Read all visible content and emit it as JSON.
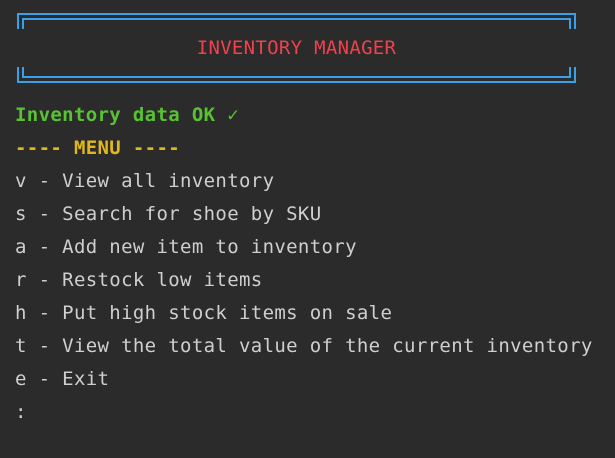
{
  "banner": {
    "title": "INVENTORY MANAGER"
  },
  "status": {
    "text": "Inventory data OK ✓"
  },
  "menu": {
    "header": "---- MENU ----",
    "items": [
      {
        "label": "v - View all inventory"
      },
      {
        "label": "s - Search for shoe by SKU"
      },
      {
        "label": "a - Add new item to inventory"
      },
      {
        "label": "r - Restock low items"
      },
      {
        "label": "h - Put high stock items on sale"
      },
      {
        "label": "t - View the total value of the current inventory"
      },
      {
        "label": "e - Exit"
      }
    ]
  },
  "prompt": {
    "text": ":"
  },
  "colors": {
    "background": "#2b2b2b",
    "frame": "#3aa0e8",
    "title": "#f0414d",
    "status": "#57c232",
    "menu_header": "#e0b81a",
    "text": "#cfcfcf"
  }
}
